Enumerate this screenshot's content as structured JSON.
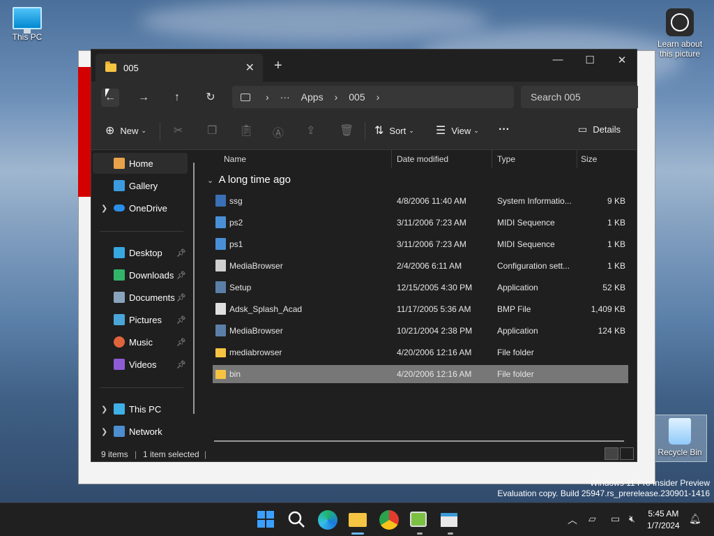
{
  "desktop": {
    "icons": [
      {
        "label": "This PC"
      },
      {
        "label": "Learn about this picture"
      },
      {
        "label": "Recycle Bin"
      }
    ],
    "watermark": {
      "line1": "Windows 11 Pro Insider Preview",
      "line2": "Evaluation copy. Build 25947.rs_prerelease.230901-1416"
    }
  },
  "window": {
    "tab_title": "005",
    "tab_close": "✕",
    "tab_new": "+",
    "controls": {
      "minimize": "—",
      "maximize": "☐",
      "close": "✕"
    }
  },
  "address": {
    "back": "←",
    "forward": "→",
    "up": "↑",
    "refresh": "↻",
    "crumbs": [
      "›",
      "···",
      "Apps",
      "›",
      "005",
      "›"
    ],
    "search_placeholder": "Search 005"
  },
  "commands": {
    "new_label": "New",
    "sort_label": "Sort",
    "view_label": "View",
    "more_label": "···",
    "details_label": "Details"
  },
  "nav": {
    "home": "Home",
    "gallery": "Gallery",
    "onedrive": "OneDrive",
    "desktop": "Desktop",
    "downloads": "Downloads",
    "documents": "Documents",
    "pictures": "Pictures",
    "music": "Music",
    "videos": "Videos",
    "thispc": "This PC",
    "network": "Network"
  },
  "columns": {
    "name": "Name",
    "date": "Date modified",
    "type": "Type",
    "size": "Size"
  },
  "group_label": "A long time ago",
  "files": [
    {
      "name": "ssg",
      "date": "4/8/2006 11:40 AM",
      "type": "System Informatio...",
      "size": "9 KB",
      "icon": "#3b6fb6"
    },
    {
      "name": "ps2",
      "date": "3/11/2006 7:23 AM",
      "type": "MIDI Sequence",
      "size": "1 KB",
      "icon": "#4a8fd6"
    },
    {
      "name": "ps1",
      "date": "3/11/2006 7:23 AM",
      "type": "MIDI Sequence",
      "size": "1 KB",
      "icon": "#4a8fd6"
    },
    {
      "name": "MediaBrowser",
      "date": "2/4/2006 6:11 AM",
      "type": "Configuration sett...",
      "size": "1 KB",
      "icon": "#cfcfcf"
    },
    {
      "name": "Setup",
      "date": "12/15/2005 4:30 PM",
      "type": "Application",
      "size": "52 KB",
      "icon": "#5b7fa8"
    },
    {
      "name": "Adsk_Splash_Acad",
      "date": "11/17/2005 5:36 AM",
      "type": "BMP File",
      "size": "1,409 KB",
      "icon": "#e0e0e0"
    },
    {
      "name": "MediaBrowser",
      "date": "10/21/2004 2:38 PM",
      "type": "Application",
      "size": "124 KB",
      "icon": "#5b7fa8"
    },
    {
      "name": "mediabrowser",
      "date": "4/20/2006 12:16 AM",
      "type": "File folder",
      "size": "",
      "icon": "#f6c443"
    },
    {
      "name": "bin",
      "date": "4/20/2006 12:16 AM",
      "type": "File folder",
      "size": "",
      "icon": "#f6c443"
    }
  ],
  "status": {
    "count": "9 items",
    "selected": "1 item selected"
  },
  "clock": {
    "time": "5:45 AM",
    "date": "1/7/2024"
  }
}
